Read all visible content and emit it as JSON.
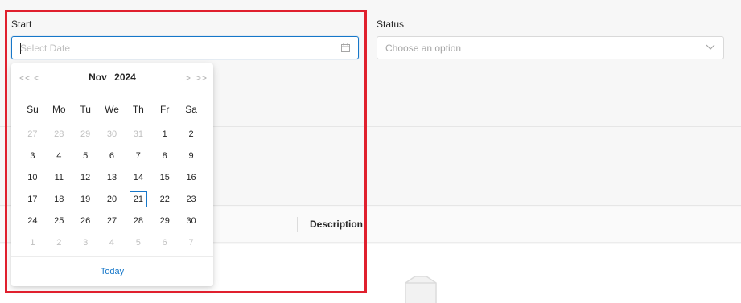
{
  "form": {
    "start_label": "Start",
    "start_placeholder": "Select Date",
    "status_label": "Status",
    "status_placeholder": "Choose an option"
  },
  "table": {
    "col_description": "Description"
  },
  "datepicker": {
    "month": "Nov",
    "year": "2024",
    "nav_prev_year": "<<",
    "nav_prev_month": "<",
    "nav_next_month": ">",
    "nav_next_year": ">>",
    "weekdays": [
      "Su",
      "Mo",
      "Tu",
      "We",
      "Th",
      "Fr",
      "Sa"
    ],
    "days": [
      {
        "label": "27",
        "muted": true
      },
      {
        "label": "28",
        "muted": true
      },
      {
        "label": "29",
        "muted": true
      },
      {
        "label": "30",
        "muted": true
      },
      {
        "label": "31",
        "muted": true
      },
      {
        "label": "1"
      },
      {
        "label": "2"
      },
      {
        "label": "3"
      },
      {
        "label": "4"
      },
      {
        "label": "5"
      },
      {
        "label": "6"
      },
      {
        "label": "7"
      },
      {
        "label": "8"
      },
      {
        "label": "9"
      },
      {
        "label": "10"
      },
      {
        "label": "11"
      },
      {
        "label": "12"
      },
      {
        "label": "13"
      },
      {
        "label": "14"
      },
      {
        "label": "15"
      },
      {
        "label": "16"
      },
      {
        "label": "17"
      },
      {
        "label": "18"
      },
      {
        "label": "19"
      },
      {
        "label": "20"
      },
      {
        "label": "21",
        "today": true
      },
      {
        "label": "22"
      },
      {
        "label": "23"
      },
      {
        "label": "24"
      },
      {
        "label": "25"
      },
      {
        "label": "26"
      },
      {
        "label": "27"
      },
      {
        "label": "28"
      },
      {
        "label": "29"
      },
      {
        "label": "30"
      },
      {
        "label": "1",
        "muted": true
      },
      {
        "label": "2",
        "muted": true
      },
      {
        "label": "3",
        "muted": true
      },
      {
        "label": "4",
        "muted": true
      },
      {
        "label": "5",
        "muted": true
      },
      {
        "label": "6",
        "muted": true
      },
      {
        "label": "7",
        "muted": true
      }
    ],
    "today_label": "Today"
  },
  "icons": {
    "calendar": "calendar-icon",
    "chevron": "chevron-down-icon",
    "empty": "empty-inbox-icon"
  },
  "colors": {
    "accent": "#1677c9",
    "highlight": "#e0202e"
  }
}
